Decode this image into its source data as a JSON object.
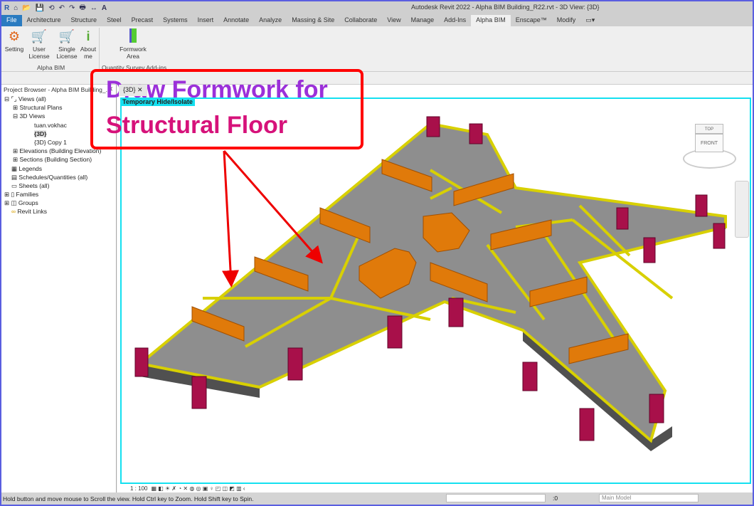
{
  "window": {
    "title": "Autodesk Revit 2022 - Alpha BIM Building_R22.rvt - 3D View: {3D}"
  },
  "quick_access": [
    "R",
    "⌂",
    "📂",
    "💾",
    "⟲",
    "↶",
    "↷",
    "🖶",
    "↔",
    "A"
  ],
  "tabs": [
    "File",
    "Architecture",
    "Structure",
    "Steel",
    "Precast",
    "Systems",
    "Insert",
    "Annotate",
    "Analyze",
    "Massing & Site",
    "Collaborate",
    "View",
    "Manage",
    "Add-Ins",
    "Alpha BIM",
    "Enscape™",
    "Modify"
  ],
  "active_tab": "Alpha BIM",
  "ribbon": {
    "alpha_bim": {
      "label": "Alpha BIM",
      "buttons": [
        "Setting",
        "User License",
        "Single License",
        "About me"
      ]
    },
    "qs": {
      "label": "Quantity Survey Add-ins",
      "buttons": [
        "Formwork Area"
      ]
    }
  },
  "browser": {
    "title": "Project Browser - Alpha BIM Building_...",
    "items": [
      "Views (all)",
      "Structural Plans",
      "3D Views",
      "tuan.vokhac",
      "{3D}",
      "{3D} Copy 1",
      "Elevations (Building Elevation)",
      "Sections (Building Section)",
      "Legends",
      "Schedules/Quantities (all)",
      "Sheets (all)",
      "Families",
      "Groups",
      "Revit Links"
    ]
  },
  "view": {
    "tab": "{3D}",
    "temp_hide": "Temporary Hide/Isolate",
    "scale": "1 : 100",
    "cube_top": "TOP",
    "cube_front": "FRONT"
  },
  "annotation": {
    "line1": "Draw Formwork for",
    "line2": "Structural Floor"
  },
  "status": {
    "message": "Hold button and move mouse to Scroll the view. Hold Ctrl key to Zoom. Hold Shift key to Spin.",
    "count": ":0",
    "model": "Main Model"
  },
  "colors": {
    "slab": "#8e8e8e",
    "beam": "#d8d000",
    "wall": "#e07a0a",
    "column": "#a8104a",
    "annotation_border": "#ff0000"
  }
}
